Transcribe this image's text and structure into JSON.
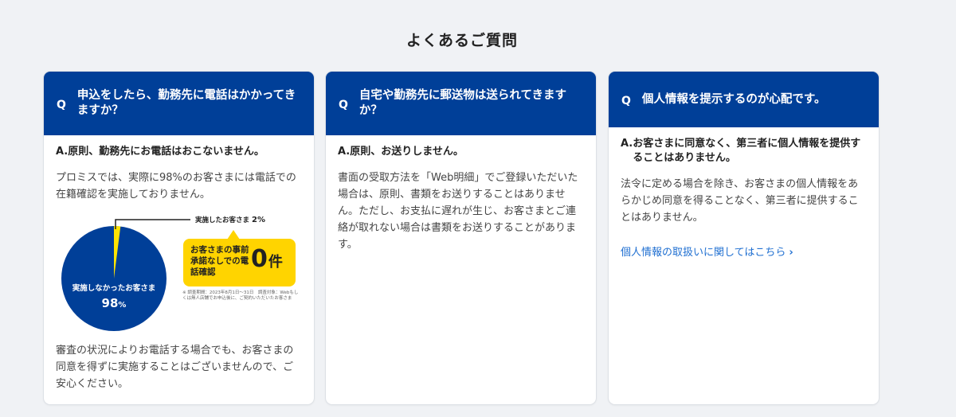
{
  "page": {
    "title": "よくあるご質問"
  },
  "faqs": [
    {
      "q_mark": "Q",
      "question": "申込をしたら、勤務先に電話はかかってきますか？",
      "answer_mark": "A.",
      "answer_lead": "原則、勤務先にお電話はおこないません。",
      "answer_text": "プロミスでは、実際に98%のお客さまには電話での在籍確認を実施しておりません。",
      "answer_text2": "審査の状況によりお電話する場合でも、お客さまの同意を得ずに実施することはございませんので、ご安心ください。",
      "infographic": {
        "implemented_label": "実施したお客さま",
        "implemented_pct": "2%",
        "not_implemented_label": "実施しなかったお客さま",
        "not_implemented_pct_num": "98",
        "not_implemented_pct_unit": "%",
        "badge_label": "お客さまの事前承諾なしでの電話確認",
        "badge_num": "0",
        "badge_unit": "件",
        "note": "※ 調査期間：2023年8月1日〜31日　調査対象：Webもしくは無人店舗でお申込後に、ご契約いただいたお客さま",
        "colors": {
          "pie_main": "#003f98",
          "pie_slice": "#ffe400",
          "badge": "#ffd400"
        }
      }
    },
    {
      "q_mark": "Q",
      "question": "自宅や勤務先に郵送物は送られてきますか？",
      "answer_mark": "A.",
      "answer_lead": "原則、お送りしません。",
      "answer_text": "書面の受取方法を「Web明細」でご登録いただいた場合は、原則、書類をお送りすることはありません。ただし、お支払に遅れが生じ、お客さまとご連絡が取れない場合は書類をお送りすることがあります。"
    },
    {
      "q_mark": "Q",
      "question": "個人情報を提示するのが心配です。",
      "answer_mark": "A.",
      "answer_lead": "お客さまに同意なく、第三者に個人情報を提供することはありません。",
      "answer_text": "法令に定める場合を除き、お客さまの個人情報をあらかじめ同意を得ることなく、第三者に提供することはありません。",
      "link_text": "個人情報の取扱いに関してはこちら",
      "link_icon": "chevron-right-icon"
    }
  ],
  "colors": {
    "header_blue": "#003f98",
    "link_blue": "#1f6fd1",
    "background": "#f0f2f5"
  }
}
